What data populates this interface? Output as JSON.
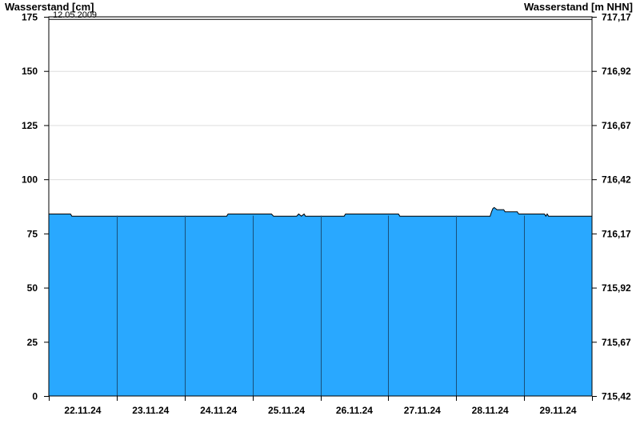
{
  "chart_data": {
    "type": "area",
    "ylabel_left": "Wasserstand [cm]",
    "ylabel_right": "Wasserstand [m NHN]",
    "ylim": [
      0,
      175
    ],
    "yticks_left": [
      "0",
      "25",
      "50",
      "75",
      "100",
      "125",
      "150",
      "175"
    ],
    "yticks_right": [
      "715,42",
      "715,67",
      "715,92",
      "716,17",
      "716,42",
      "716,67",
      "716,92",
      "717,17"
    ],
    "xlim_days": [
      0,
      8
    ],
    "x_tick_labels": [
      "22.11.24",
      "23.11.24",
      "24.11.24",
      "25.11.24",
      "26.11.24",
      "27.11.24",
      "28.11.24",
      "29.11.24"
    ],
    "reference_line": {
      "label": "12.05.2009",
      "value": 174
    },
    "series": [
      {
        "fill_color": "#29a8ff",
        "x": [
          0,
          0.32,
          0.34,
          2.62,
          2.64,
          3.28,
          3.31,
          3.65,
          3.68,
          3.72,
          3.76,
          3.78,
          3.82,
          4.35,
          4.37,
          5.15,
          5.17,
          6.5,
          6.52,
          6.54,
          6.56,
          6.58,
          6.6,
          6.7,
          6.72,
          6.9,
          6.92,
          7.3,
          7.32,
          7.34,
          7.36,
          7.38,
          8
        ],
        "values": [
          84,
          84,
          83,
          83,
          84,
          84,
          83,
          83,
          84,
          83,
          84,
          83,
          83,
          83,
          84,
          84,
          83,
          83,
          85,
          86.5,
          87,
          86.5,
          86,
          86,
          85,
          85,
          84,
          84,
          83,
          84,
          83,
          83,
          83
        ]
      }
    ],
    "grid": true
  },
  "colors": {
    "area": "#29a8ff",
    "grid": "#dddddd",
    "axis": "#000000"
  }
}
